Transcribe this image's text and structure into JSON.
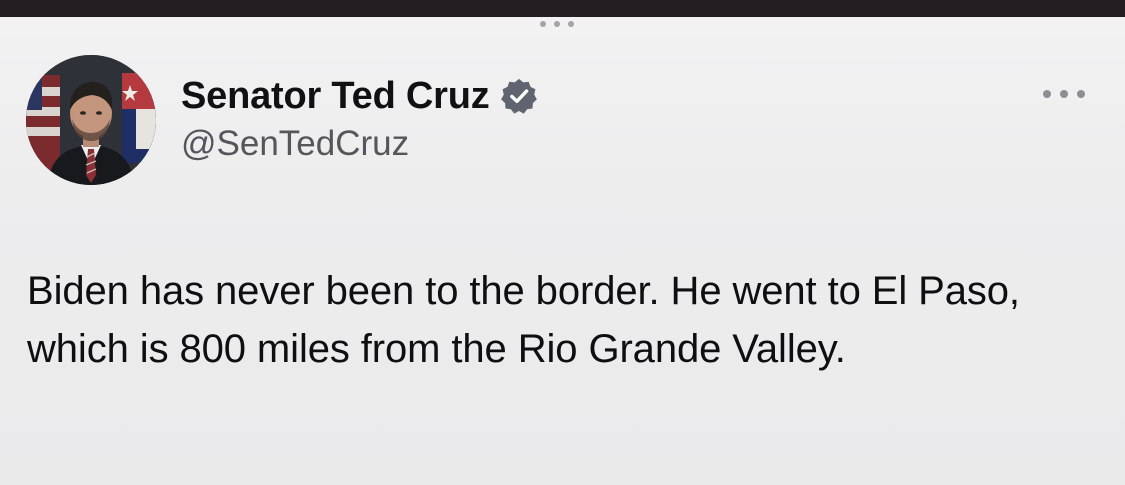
{
  "app": {
    "grabber_icon": "ellipsis-grabber-icon",
    "more_icon": "more-options-icon"
  },
  "profile": {
    "display_name": "Senator Ted Cruz",
    "verified_icon": "verified-badge-icon",
    "verified_color": "#5f6470",
    "handle": "@SenTedCruz"
  },
  "tweet": {
    "text": "Biden has never been to the border. He went to El Paso, which is 800 miles from the Rio Grande Valley."
  }
}
